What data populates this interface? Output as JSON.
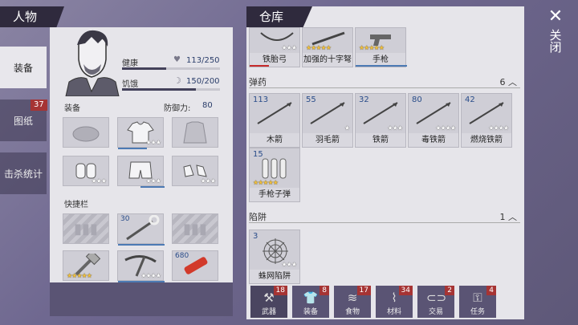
{
  "character": {
    "title": "人物",
    "stats": {
      "health_label": "健康",
      "health_value": "113/250",
      "health_frac": 0.45,
      "hunger_label": "饥饿",
      "hunger_value": "150/200",
      "hunger_frac": 0.75
    },
    "equip_label": "装备",
    "defense_label": "防御力:",
    "defense_value": "80",
    "quickbar_label": "快捷栏",
    "quick_slot_counts": {
      "hook": "30",
      "dynamite": "680"
    }
  },
  "side_tabs": {
    "equip": "装备",
    "blueprint": "图纸",
    "blueprint_badge": "37",
    "kills": "击杀统计"
  },
  "warehouse": {
    "title": "仓库",
    "top_items": [
      {
        "name": "铁胎弓",
        "stars": "★★★",
        "gold": false
      },
      {
        "name": "加强的十字弩",
        "stars": "★★★★★",
        "gold": true
      },
      {
        "name": "手枪",
        "stars": "★★★★★",
        "gold": true
      }
    ],
    "ammo_label": "弹药",
    "ammo_count": "6",
    "ammo": [
      {
        "name": "木箭",
        "count": "113",
        "stars": ""
      },
      {
        "name": "羽毛箭",
        "count": "55",
        "stars": "★"
      },
      {
        "name": "铁箭",
        "count": "32",
        "stars": "★★★"
      },
      {
        "name": "毒铁箭",
        "count": "80",
        "stars": "★★★★"
      },
      {
        "name": "燃烧铁箭",
        "count": "42",
        "stars": "★★★★"
      },
      {
        "name": "手枪子弹",
        "count": "15",
        "stars": "★★★★★"
      }
    ],
    "trap_label": "陷阱",
    "trap_count": "1",
    "traps": [
      {
        "name": "蛛网陷阱",
        "count": "3",
        "stars": "★★★"
      }
    ]
  },
  "bottom_tabs": [
    {
      "label": "武器",
      "badge": "18"
    },
    {
      "label": "装备",
      "badge": "8"
    },
    {
      "label": "食物",
      "badge": "17"
    },
    {
      "label": "材料",
      "badge": "34"
    },
    {
      "label": "交易",
      "badge": "2"
    },
    {
      "label": "任务",
      "badge": "4"
    }
  ],
  "close": {
    "icon": "✕",
    "label": "关闭"
  },
  "colors": {
    "header": "#2f2a3d",
    "badge": "#a63434",
    "panel": "#e6e5ea"
  }
}
